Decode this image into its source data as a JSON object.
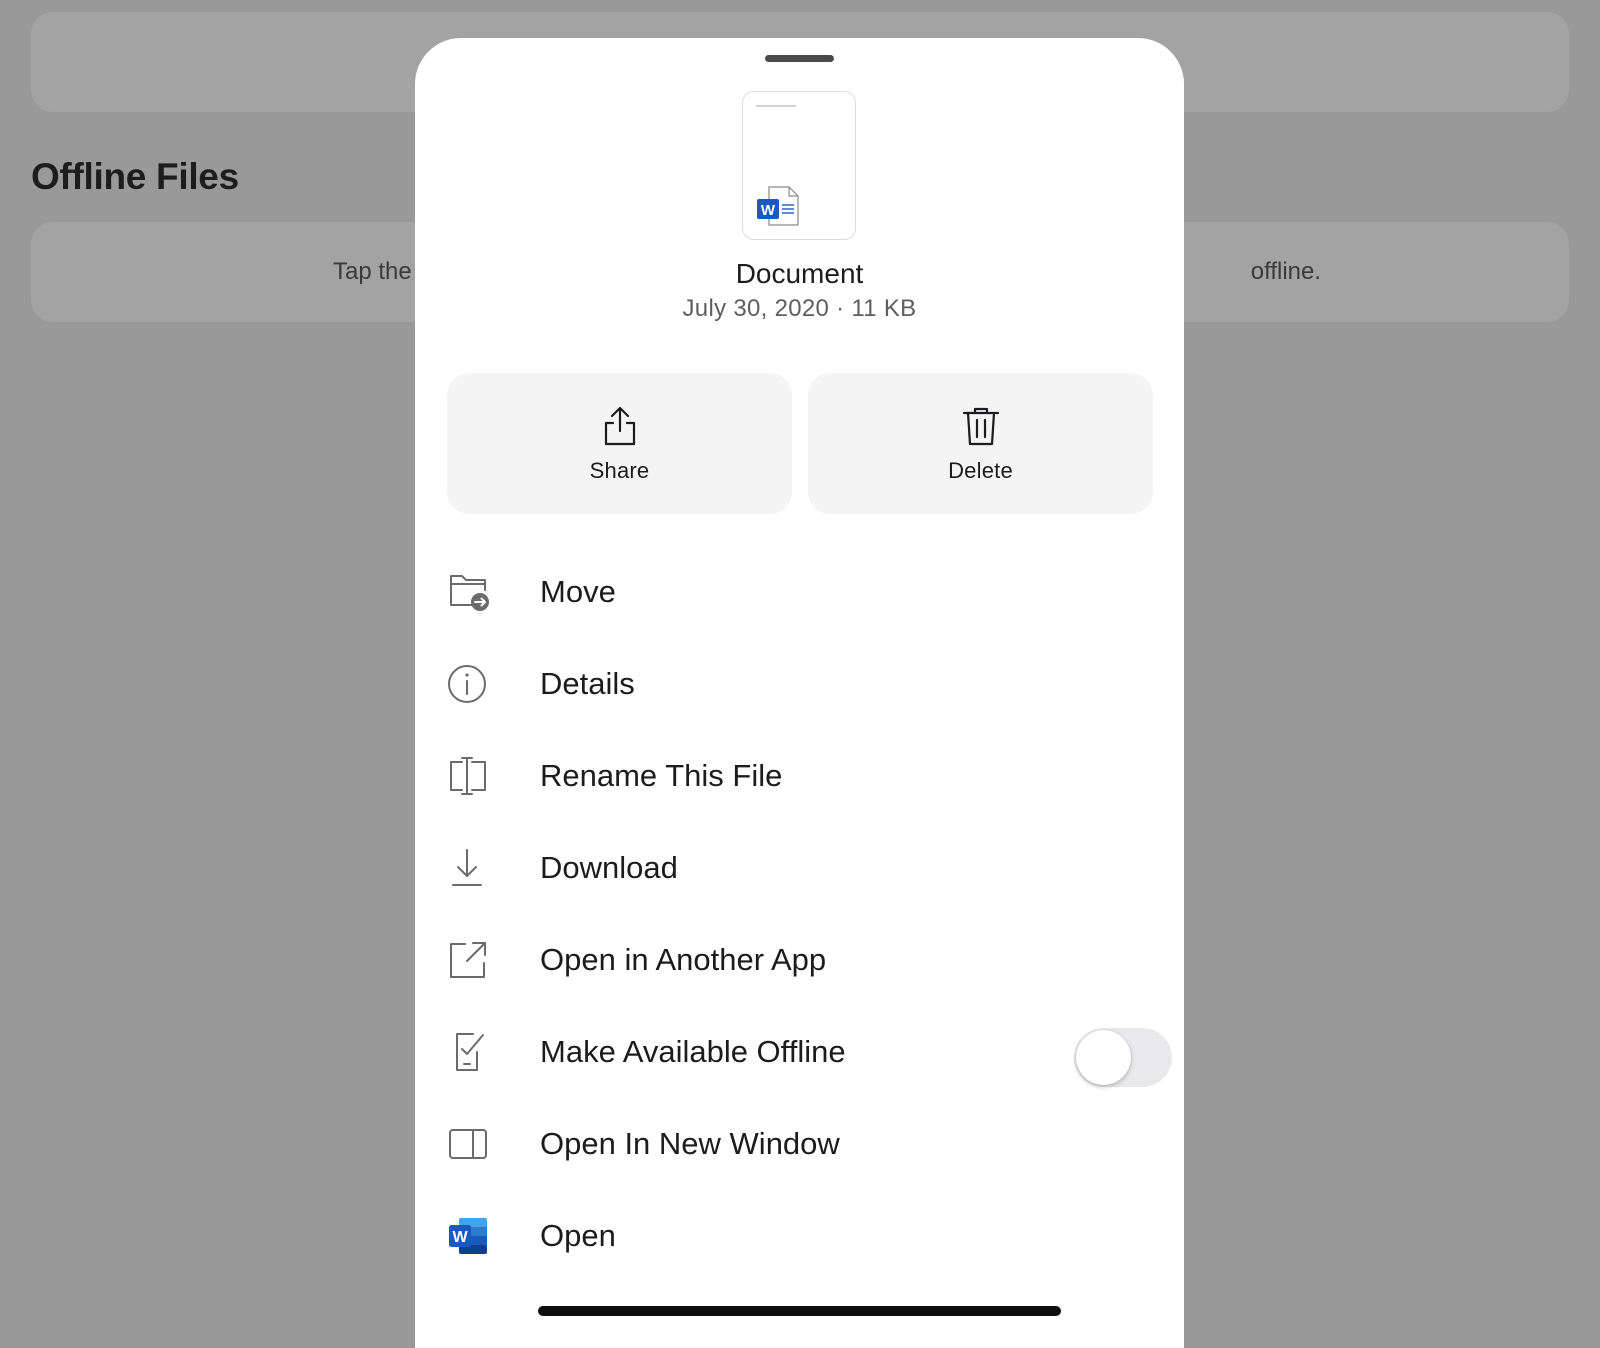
{
  "background": {
    "section_title": "Offline Files",
    "message_visible_left": "Tap the",
    "message_visible_right": "offline."
  },
  "sheet": {
    "file": {
      "name": "Document",
      "meta": "July 30, 2020 · 11 KB"
    },
    "actions": {
      "share_label": "Share",
      "delete_label": "Delete"
    },
    "menu": [
      {
        "label": "Move",
        "icon": "folder-move-icon"
      },
      {
        "label": "Details",
        "icon": "info-icon"
      },
      {
        "label": "Rename This File",
        "icon": "rename-icon"
      },
      {
        "label": "Download",
        "icon": "download-icon"
      },
      {
        "label": "Open in Another App",
        "icon": "open-external-icon"
      },
      {
        "label": "Make Available Offline",
        "icon": "offline-device-icon",
        "toggle_on": false
      },
      {
        "label": "Open In New Window",
        "icon": "new-window-icon"
      },
      {
        "label": "Open",
        "icon": "word-app-icon"
      }
    ]
  },
  "colors": {
    "word_blue": "#185abd",
    "scrim": "#999999"
  }
}
